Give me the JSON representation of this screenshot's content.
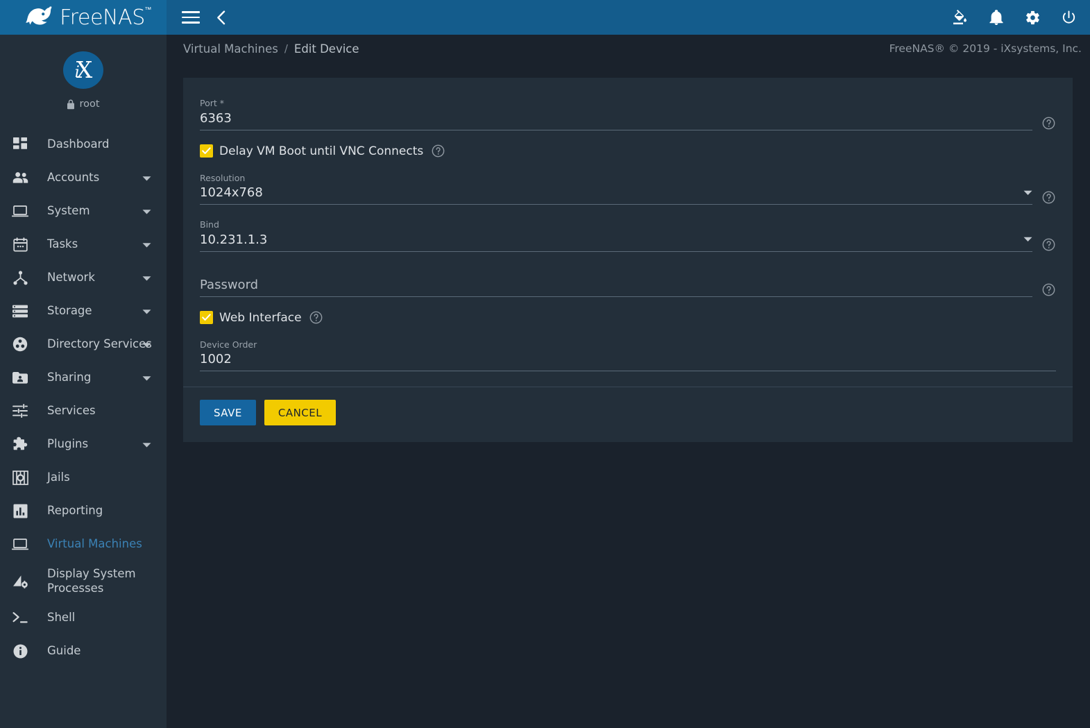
{
  "brand": {
    "name": "FreeNAS",
    "trademark": "™"
  },
  "topbar": {
    "menu_toggle_icon": "hamburger-icon",
    "back_icon": "chevron-left-icon",
    "icons": [
      {
        "name": "theme-paint-icon",
        "label": "Change Theme"
      },
      {
        "name": "notifications-bell-icon",
        "label": "Notifications"
      },
      {
        "name": "settings-gear-icon",
        "label": "Settings"
      },
      {
        "name": "power-icon",
        "label": "Power"
      }
    ]
  },
  "sidebar": {
    "avatar_initials": {
      "i": "i",
      "x": "X"
    },
    "username": "root",
    "lock_icon": "lock-icon",
    "items": [
      {
        "label": "Dashboard",
        "icon": "dashboard-icon",
        "expandable": false,
        "active": false
      },
      {
        "label": "Accounts",
        "icon": "accounts-people-icon",
        "expandable": true,
        "active": false
      },
      {
        "label": "System",
        "icon": "system-laptop-icon",
        "expandable": true,
        "active": false
      },
      {
        "label": "Tasks",
        "icon": "tasks-calendar-icon",
        "expandable": true,
        "active": false
      },
      {
        "label": "Network",
        "icon": "network-nodes-icon",
        "expandable": true,
        "active": false
      },
      {
        "label": "Storage",
        "icon": "storage-disks-icon",
        "expandable": true,
        "active": false
      },
      {
        "label": "Directory Services",
        "icon": "directory-services-icon",
        "expandable": true,
        "active": false
      },
      {
        "label": "Sharing",
        "icon": "sharing-folder-icon",
        "expandable": true,
        "active": false
      },
      {
        "label": "Services",
        "icon": "services-sliders-icon",
        "expandable": false,
        "active": false
      },
      {
        "label": "Plugins",
        "icon": "plugins-puzzle-icon",
        "expandable": true,
        "active": false
      },
      {
        "label": "Jails",
        "icon": "jails-icon",
        "expandable": false,
        "active": false
      },
      {
        "label": "Reporting",
        "icon": "reporting-chart-icon",
        "expandable": false,
        "active": false
      },
      {
        "label": "Virtual Machines",
        "icon": "vm-laptop-icon",
        "expandable": false,
        "active": true
      },
      {
        "label": "Display System Processes",
        "icon": "processes-icon",
        "expandable": false,
        "active": false
      },
      {
        "label": "Shell",
        "icon": "shell-prompt-icon",
        "expandable": false,
        "active": false
      },
      {
        "label": "Guide",
        "icon": "guide-info-icon",
        "expandable": false,
        "active": false
      }
    ]
  },
  "breadcrumb": {
    "parent": "Virtual Machines",
    "separator": "/",
    "current": "Edit Device"
  },
  "copyright": "FreeNAS® © 2019 - iXsystems, Inc.",
  "form": {
    "port": {
      "label": "Port *",
      "value": "6363",
      "help_icon": "help-circle-icon"
    },
    "delay_vm_boot": {
      "label": "Delay VM Boot until VNC Connects",
      "checked": true,
      "help_icon": "help-circle-icon"
    },
    "resolution": {
      "label": "Resolution",
      "value": "1024x768",
      "caret_icon": "chevron-down-icon",
      "help_icon": "help-circle-icon"
    },
    "bind": {
      "label": "Bind",
      "value": "10.231.1.3",
      "caret_icon": "chevron-down-icon",
      "help_icon": "help-circle-icon"
    },
    "password": {
      "placeholder": "Password",
      "value": "",
      "help_icon": "help-circle-icon"
    },
    "web_interface": {
      "label": "Web Interface",
      "checked": true,
      "help_icon": "help-circle-icon"
    },
    "device_order": {
      "label": "Device Order",
      "value": "1002"
    }
  },
  "actions": {
    "save_label": "SAVE",
    "cancel_label": "CANCEL"
  },
  "colors": {
    "brand_blue": "#14679b",
    "topbar_blue": "#145c8c",
    "sidebar_bg": "#232f3a",
    "content_bg": "#1a222c",
    "card_bg": "#232f3a",
    "accent_yellow": "#f2cb00",
    "save_blue": "#1565a0",
    "active_link": "#3b82b5"
  }
}
